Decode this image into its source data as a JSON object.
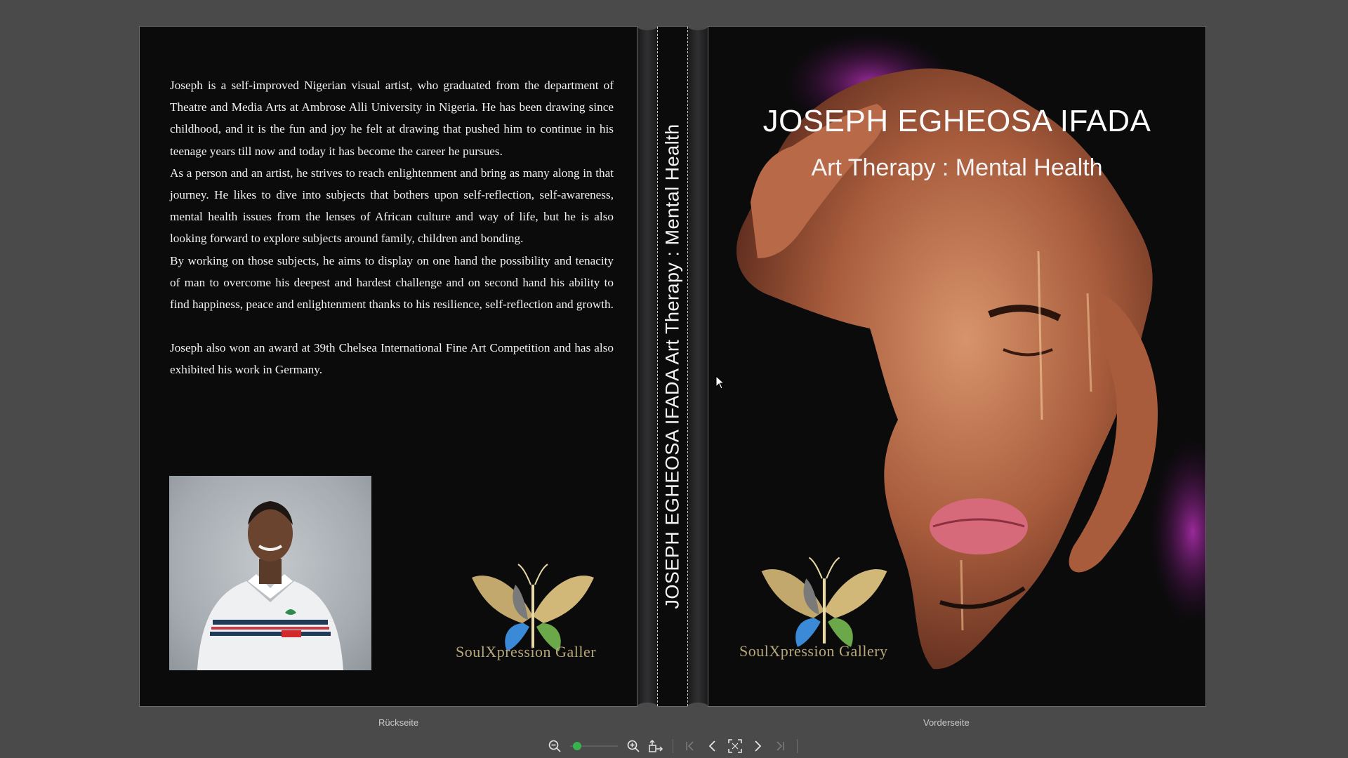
{
  "back_cover": {
    "bio_paragraphs": [
      "Joseph is a self-improved Nigerian visual artist, who graduated from the department of Theatre and Media Arts at Ambrose Alli University in Nigeria. He has been drawing since childhood, and it is the fun and joy he felt at drawing that pushed him to continue in his teenage years till now and today it has become the career he pursues.",
      "As a person and an artist, he strives to reach enlightenment and bring as many along in that journey. He likes to dive into subjects that bothers upon self-reflection, self-awareness, mental health issues from the lenses of African culture and way of life, but he is also looking forward to explore subjects around family, children and bonding.",
      "By working on those subjects, he aims to display on one hand the possibility and tenacity of man to overcome his deepest and hardest challenge and on second hand his ability to find happiness, peace and enlightenment thanks to his resilience, self-reflection and growth.",
      "Joseph also won an award at 39th Chelsea International Fine Art Competition and has also exhibited his work in Germany."
    ],
    "logo_text": "SoulXpression Galler"
  },
  "spine": {
    "text": "JOSEPH EGHEOSA IFADA Art Therapy : Mental Health"
  },
  "front_cover": {
    "title": "JOSEPH EGHEOSA IFADA",
    "subtitle": "Art Therapy : Mental Health",
    "logo_text": "SoulXpression Gallery"
  },
  "labels": {
    "back": "Rückseite",
    "front": "Vorderseite"
  },
  "toolbar": {
    "zoom_level": 0.15,
    "icons": [
      "zoom-out-icon",
      "zoom-in-icon",
      "page-layout-icon",
      "first-page-icon",
      "previous-page-icon",
      "fullscreen-icon",
      "next-page-icon",
      "last-page-icon"
    ]
  },
  "colors": {
    "background": "#4a4a4a",
    "page": "#0b0b0c",
    "accent": "#37b24d",
    "logo_gold": "#b8a77a"
  }
}
